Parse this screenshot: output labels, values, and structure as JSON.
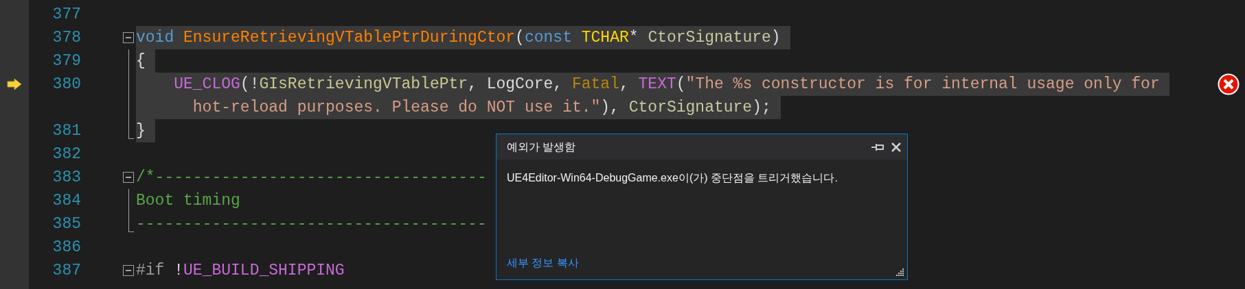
{
  "editor": {
    "lines": [
      {
        "number": "377",
        "kind": "plain",
        "selected": false,
        "current": false,
        "error": false
      },
      {
        "number": "378",
        "kind": "fold-start",
        "selected": true,
        "current": false,
        "error": false,
        "tokens": [
          {
            "text": "void ",
            "kind": "keyword"
          },
          {
            "text": "EnsureRetrievingVTablePtrDuringCtor",
            "kind": "function"
          },
          {
            "text": "(",
            "kind": "plain"
          },
          {
            "text": "const ",
            "kind": "keyword"
          },
          {
            "text": "TCHAR",
            "kind": "type"
          },
          {
            "text": "* ",
            "kind": "plain"
          },
          {
            "text": "CtorSignature",
            "kind": "param"
          },
          {
            "text": ")",
            "kind": "plain"
          }
        ]
      },
      {
        "number": "379",
        "kind": "fold-body",
        "selected": true,
        "current": false,
        "error": false,
        "tokens": [
          {
            "text": "{",
            "kind": "plain"
          }
        ]
      },
      {
        "number": "380",
        "kind": "fold-body",
        "selected": true,
        "current": true,
        "error": true,
        "tokens": [
          {
            "text": "    UE_CLOG",
            "kind": "macro"
          },
          {
            "text": "(!",
            "kind": "plain"
          },
          {
            "text": "GIsRetrievingVTablePtr",
            "kind": "global"
          },
          {
            "text": ", LogCore, ",
            "kind": "plain"
          },
          {
            "text": "Fatal",
            "kind": "enum"
          },
          {
            "text": ", ",
            "kind": "plain"
          },
          {
            "text": "TEXT",
            "kind": "macro"
          },
          {
            "text": "(",
            "kind": "plain"
          },
          {
            "text": "\"The %s constructor is for internal usage only for",
            "kind": "string"
          }
        ]
      },
      {
        "kind": "fold-body",
        "selected": true,
        "current": false,
        "error": false,
        "tokens": [
          {
            "text": "      hot-reload purposes. Please do NOT use it.\"",
            "kind": "string"
          },
          {
            "text": "), ",
            "kind": "plain"
          },
          {
            "text": "CtorSignature",
            "kind": "param"
          },
          {
            "text": ");",
            "kind": "plain"
          }
        ]
      },
      {
        "number": "381",
        "kind": "fold-end",
        "selected": true,
        "current": false,
        "error": false,
        "tokens": [
          {
            "text": "}",
            "kind": "plain"
          }
        ]
      },
      {
        "number": "382",
        "kind": "plain",
        "selected": false,
        "current": false,
        "error": false
      },
      {
        "number": "383",
        "kind": "fold-start",
        "selected": false,
        "current": false,
        "error": false,
        "tokens": [
          {
            "text": "/*-----------------------------------",
            "kind": "comment"
          }
        ]
      },
      {
        "number": "384",
        "kind": "fold-body",
        "selected": false,
        "current": false,
        "error": false,
        "tokens": [
          {
            "text": "Boot timing",
            "kind": "comment"
          }
        ]
      },
      {
        "number": "385",
        "kind": "fold-end",
        "selected": false,
        "current": false,
        "error": false,
        "tokens": [
          {
            "text": "-------------------------------------",
            "kind": "comment"
          }
        ]
      },
      {
        "number": "386",
        "kind": "plain",
        "selected": false,
        "current": false,
        "error": false
      },
      {
        "number": "387",
        "kind": "fold-start",
        "selected": false,
        "current": false,
        "error": false,
        "tokens": [
          {
            "text": "#if",
            "kind": "preprocessor"
          },
          {
            "text": " !",
            "kind": "plain"
          },
          {
            "text": "UE_BUILD_SHIPPING",
            "kind": "macro"
          }
        ]
      }
    ]
  },
  "popup": {
    "title": "예외가 발생함",
    "message": "UE4Editor-Win64-DebugGame.exe이(가) 중단점을 트리거했습니다.",
    "link": "세부 정보 복사"
  }
}
